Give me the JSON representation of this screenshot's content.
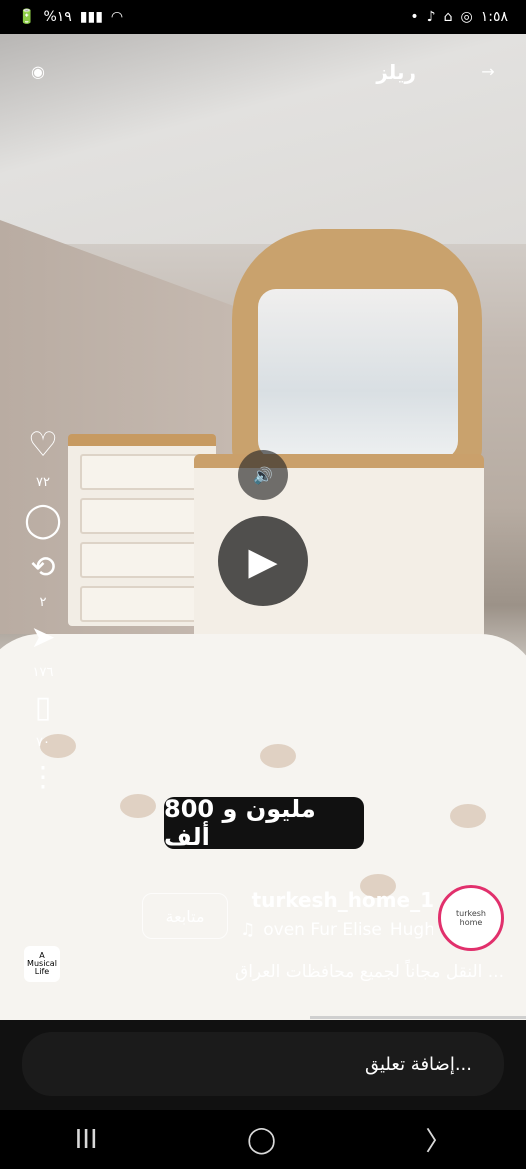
{
  "status_bar": {
    "battery": "%١٩",
    "time": "١:٥٨"
  },
  "header": {
    "title": "ريلز",
    "camera_icon": "camera-icon",
    "back_icon": "arrow-right-icon"
  },
  "actions": {
    "likes": "٧٢",
    "shares": "٢",
    "sends": "١٧٦",
    "saves": "٧٠"
  },
  "overlay": {
    "price_text": "مليون و 800 ألف"
  },
  "creator": {
    "username": "turkesh_home_1",
    "follow_label": "متابعة",
    "music_text": "oven Fur Elise",
    "music_artist": "Hugh",
    "avatar_text": "turkesh home",
    "caption": "النقل مجاناً لجميع محافظات العراق ..."
  },
  "music_badge": {
    "line1": "A",
    "line2": "Musical",
    "line3": "Life"
  },
  "comment": {
    "placeholder": "إضافة تعليق..."
  },
  "nav": {
    "recent": "III",
    "home": "◯",
    "back": "〉"
  }
}
